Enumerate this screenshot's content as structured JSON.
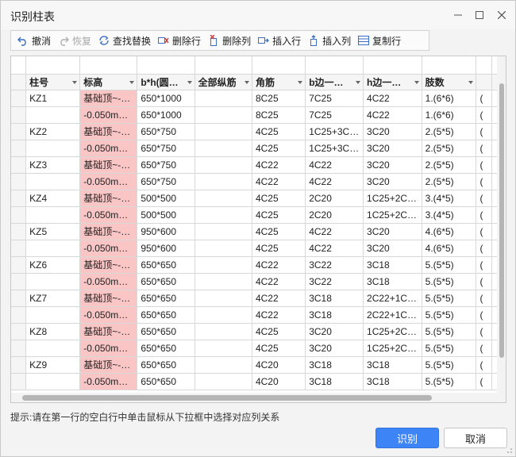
{
  "window": {
    "title": "识别柱表"
  },
  "toolbar": {
    "undo": "撤消",
    "redo": "恢复",
    "find_replace": "查找替换",
    "delete_row": "删除行",
    "delete_col": "删除列",
    "insert_row": "插入行",
    "insert_col": "插入列",
    "copy_row": "复制行"
  },
  "table": {
    "columns": [
      "柱号",
      "标高",
      "b*h(圆…",
      "全部纵筋",
      "角筋",
      "b边一…",
      "h边一…",
      "肢数",
      ""
    ],
    "rows": [
      [
        "KZ1",
        "基础顶~-…",
        "650*1000",
        "",
        "8C25",
        "7C25",
        "4C22",
        "1.(6*6)",
        "("
      ],
      [
        "",
        "-0.050m…",
        "650*1000",
        "",
        "8C25",
        "7C25",
        "4C22",
        "1.(6*6)",
        "("
      ],
      [
        "KZ2",
        "基础顶~-…",
        "650*750",
        "",
        "4C25",
        "1C25+3C…",
        "3C20",
        "2.(5*5)",
        "("
      ],
      [
        "",
        "-0.050m…",
        "650*750",
        "",
        "4C25",
        "1C25+3C…",
        "3C20",
        "2.(5*5)",
        "("
      ],
      [
        "KZ3",
        "基础顶~-…",
        "650*750",
        "",
        "4C22",
        "4C22",
        "3C20",
        "2.(5*5)",
        "("
      ],
      [
        "",
        "-0.050m…",
        "650*750",
        "",
        "4C22",
        "4C22",
        "3C20",
        "2.(5*5)",
        "("
      ],
      [
        "KZ4",
        "基础顶~-…",
        "500*500",
        "",
        "4C25",
        "2C20",
        "1C25+2C…",
        "3.(4*5)",
        "("
      ],
      [
        "",
        "-0.050m…",
        "500*500",
        "",
        "4C25",
        "2C20",
        "1C25+2C…",
        "3.(4*5)",
        "("
      ],
      [
        "KZ5",
        "基础顶~-…",
        "950*600",
        "",
        "4C25",
        "4C22",
        "3C20",
        "4.(6*5)",
        "("
      ],
      [
        "",
        "-0.050m…",
        "950*600",
        "",
        "4C25",
        "4C22",
        "3C20",
        "4.(6*5)",
        "("
      ],
      [
        "KZ6",
        "基础顶~-…",
        "650*650",
        "",
        "4C22",
        "3C22",
        "3C18",
        "5.(5*5)",
        "("
      ],
      [
        "",
        "-0.050m…",
        "650*650",
        "",
        "4C22",
        "3C22",
        "3C18",
        "5.(5*5)",
        "("
      ],
      [
        "KZ7",
        "基础顶~-…",
        "650*650",
        "",
        "4C22",
        "3C18",
        "2C22+1C…",
        "5.(5*5)",
        "("
      ],
      [
        "",
        "-0.050m…",
        "650*650",
        "",
        "4C22",
        "3C18",
        "2C22+1C…",
        "5.(5*5)",
        "("
      ],
      [
        "KZ8",
        "基础顶~-…",
        "650*650",
        "",
        "4C25",
        "3C20",
        "1C25+2C…",
        "5.(5*5)",
        "("
      ],
      [
        "",
        "-0.050m…",
        "650*650",
        "",
        "4C25",
        "3C20",
        "1C25+2C…",
        "5.(5*5)",
        "("
      ],
      [
        "KZ9",
        "基础顶~-…",
        "650*650",
        "",
        "4C20",
        "3C18",
        "3C18",
        "5.(5*5)",
        "("
      ],
      [
        "",
        "-0.050m…",
        "650*650",
        "",
        "4C20",
        "3C18",
        "3C18",
        "5.(5*5)",
        "("
      ]
    ]
  },
  "hint": "提示:请在第一行的空白行中单击鼠标从下拉框中选择对应列关系",
  "buttons": {
    "ok": "识别",
    "cancel": "取消"
  },
  "colors": {
    "highlight_column": "#f9c5c5",
    "primary_button": "#3d84f7"
  }
}
